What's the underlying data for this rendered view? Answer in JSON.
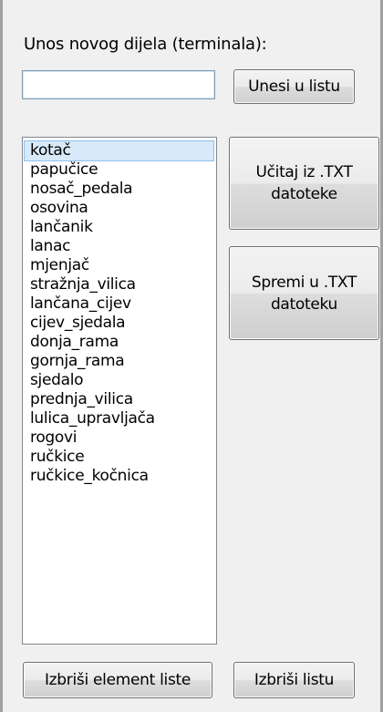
{
  "form": {
    "input_label": "Unos novog dijela (terminala):",
    "input_value": ""
  },
  "buttons": {
    "add": "Unesi u listu",
    "load_txt": "Učitaj iz .TXT datoteke",
    "save_txt": "Spremi u .TXT datoteku",
    "delete_item": "Izbriši element liste",
    "delete_list": "Izbriši listu"
  },
  "list": {
    "selected_index": 0,
    "items": [
      "kotač",
      "papučice",
      "nosač_pedala",
      "osovina",
      "lančanik",
      "lanac",
      "mjenjač",
      "stražnja_vilica",
      "lančana_cijev",
      "cijev_sjedala",
      "donja_rama",
      "gornja_rama",
      "sjedalo",
      "prednja_vilica",
      "lulica_upravljača",
      "rogovi",
      "ručkice",
      "ručkice_kočnica"
    ]
  }
}
